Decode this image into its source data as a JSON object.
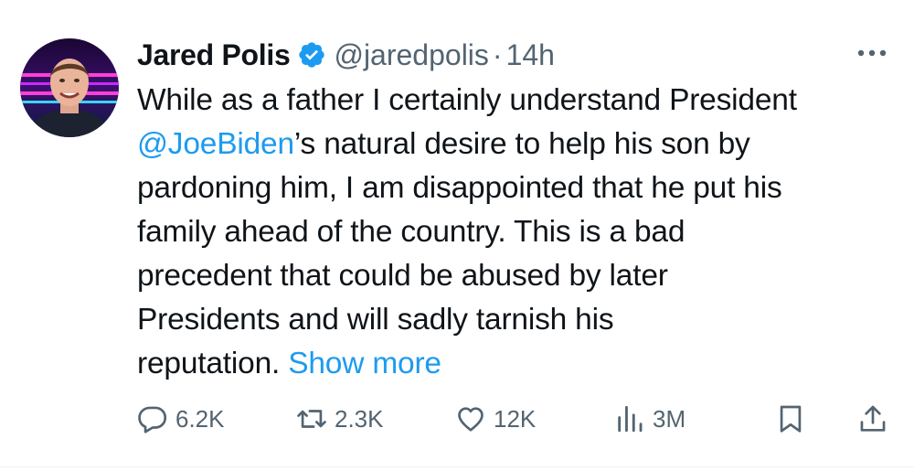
{
  "tweet": {
    "author": {
      "display_name": "Jared Polis",
      "handle": "@jaredpolis",
      "verified": true
    },
    "separator": "·",
    "timestamp": "14h",
    "body": {
      "line1": "While as a father I certainly understand President",
      "mention": "@JoeBiden",
      "line2_rest": "’s natural desire to help his son by",
      "line3": "pardoning him, I am disappointed that he put his",
      "line4": "family ahead of the country. This is a bad",
      "line5": "precedent that could be abused by later",
      "line6": "Presidents and will sadly tarnish his",
      "line7": "reputation.",
      "show_more": "Show more"
    },
    "actions": {
      "replies": "6.2K",
      "reposts": "2.3K",
      "likes": "12K",
      "views": "3M"
    }
  },
  "icons": {
    "verified": "verified-badge-icon",
    "more": "more-dots-icon",
    "reply": "reply-icon",
    "repost": "repost-icon",
    "like": "heart-icon",
    "views": "views-chart-icon",
    "bookmark": "bookmark-icon",
    "share": "share-icon"
  },
  "colors": {
    "text": "#0f1419",
    "secondary": "#536471",
    "accent": "#1d9bf0"
  }
}
